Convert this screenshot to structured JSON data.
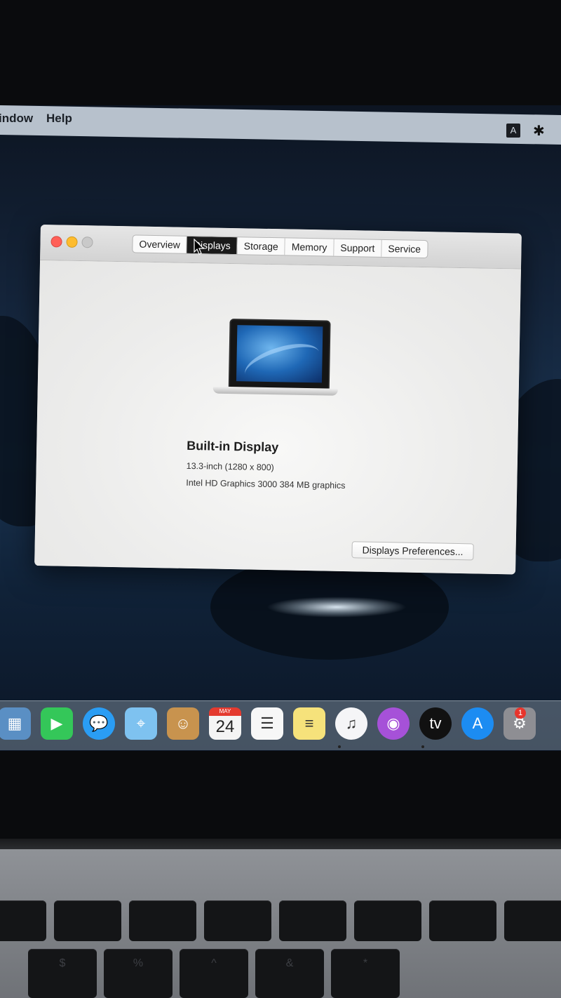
{
  "menubar": {
    "items": [
      "indow",
      "Help"
    ],
    "status_input_source": "A",
    "status_bluetooth": "✱"
  },
  "window": {
    "tabs": [
      {
        "label": "Overview",
        "active": false
      },
      {
        "label": "Displays",
        "active": true
      },
      {
        "label": "Storage",
        "active": false
      },
      {
        "label": "Memory",
        "active": false
      },
      {
        "label": "Support",
        "active": false
      },
      {
        "label": "Service",
        "active": false
      }
    ],
    "display": {
      "title": "Built-in Display",
      "size": "13.3-inch (1280 x 800)",
      "graphics": "Intel HD Graphics 3000 384 MB graphics"
    },
    "prefs_button": "Displays Preferences..."
  },
  "dock": {
    "items": [
      {
        "name": "preview-icon",
        "glyph": "▦",
        "color": "#5a8fc4"
      },
      {
        "name": "facetime-icon",
        "glyph": "▶",
        "color": "#34c759"
      },
      {
        "name": "messages-icon",
        "glyph": "💬",
        "color": "#2a9df4"
      },
      {
        "name": "maps-icon",
        "glyph": "⌖",
        "color": "#7ec2f0"
      },
      {
        "name": "contacts-icon",
        "glyph": "☺",
        "color": "#c8934e"
      },
      {
        "name": "calendar-icon",
        "glyph": "24",
        "color": "#f4f4f4"
      },
      {
        "name": "reminders-icon",
        "glyph": "☰",
        "color": "#f7f7f7"
      },
      {
        "name": "notes-icon",
        "glyph": "≡",
        "color": "#f6e27b"
      },
      {
        "name": "music-icon",
        "glyph": "♫",
        "color": "#f5f5f7"
      },
      {
        "name": "podcasts-icon",
        "glyph": "◉",
        "color": "#a651d8"
      },
      {
        "name": "apple-tv-icon",
        "glyph": "tv",
        "color": "#111111"
      },
      {
        "name": "app-store-icon",
        "glyph": "A",
        "color": "#1c8cf2"
      },
      {
        "name": "system-preferences-icon",
        "glyph": "⚙",
        "color": "#8e8e93"
      }
    ],
    "calendar_month": "MAY",
    "calendar_day": "24",
    "system_prefs_badge": "1"
  },
  "keyboard": {
    "row1": [
      "",
      "",
      "",
      "",
      "",
      "",
      "",
      ""
    ],
    "row2": [
      "$",
      "%",
      "^",
      "&",
      "*"
    ]
  }
}
